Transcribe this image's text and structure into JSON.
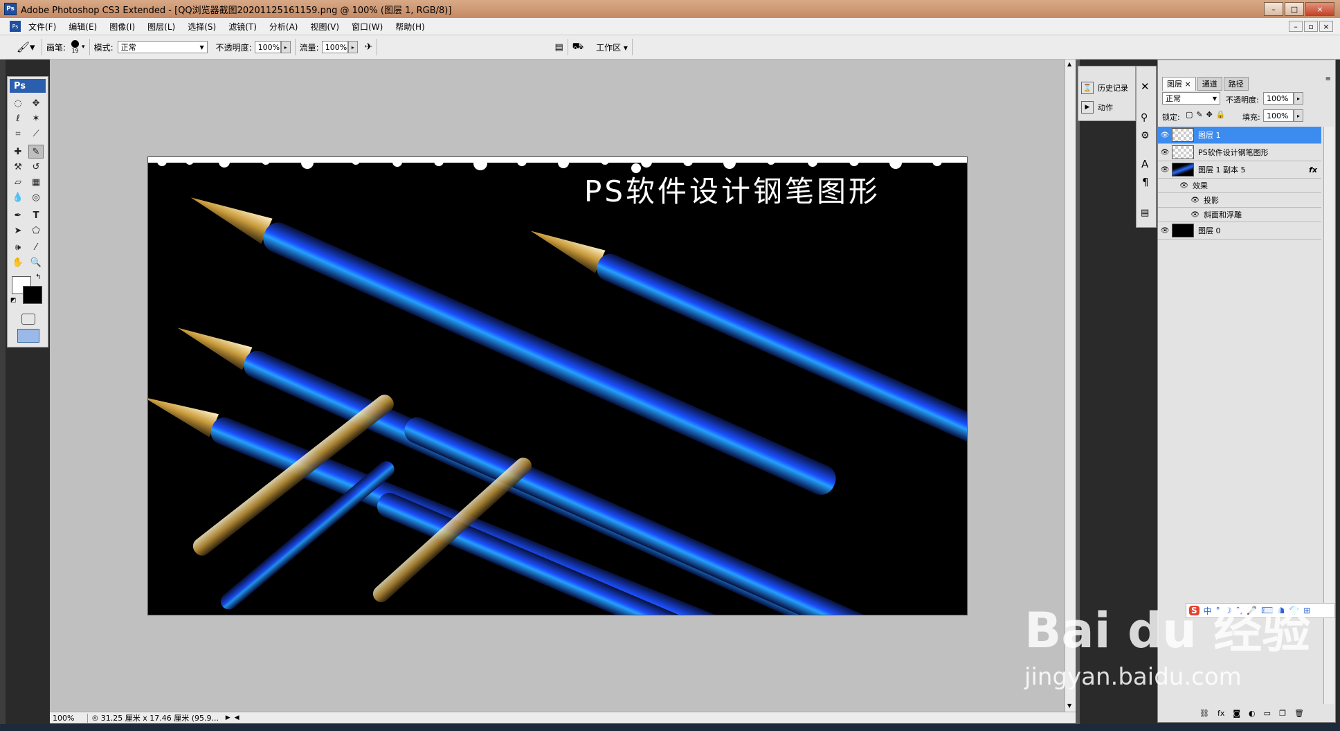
{
  "window": {
    "title": "Adobe Photoshop CS3 Extended - [QQ浏览器截图20201125161159.png @ 100% (图层 1, RGB/8)]",
    "app_icon": "Ps",
    "controls": [
      "–",
      "□",
      "×"
    ],
    "doc_controls": [
      "–",
      "▫",
      "×"
    ]
  },
  "menu": [
    "文件(F)",
    "编辑(E)",
    "图像(I)",
    "图层(L)",
    "选择(S)",
    "滤镜(T)",
    "分析(A)",
    "视图(V)",
    "窗口(W)",
    "帮助(H)"
  ],
  "options": {
    "brush_label": "画笔:",
    "brush_size": "19",
    "mode_label": "模式:",
    "mode_value": "正常",
    "opacity_label": "不透明度:",
    "opacity_value": "100%",
    "flow_label": "流量:",
    "flow_value": "100%",
    "workspace_label": "工作区 ▾"
  },
  "toolbox": {
    "logo": "Ps"
  },
  "canvas": {
    "text": "PS软件设计钢笔图形",
    "bg_color": "#000000",
    "accent_blue": "#1a5aff"
  },
  "status": {
    "zoom": "100%",
    "doc_info": "31.25 厘米 x 17.46 厘米 (95.9..."
  },
  "history_panel": {
    "items": [
      {
        "label": "历史记录",
        "icon": "history-icon"
      },
      {
        "label": "动作",
        "icon": "actions-icon"
      }
    ]
  },
  "layers_panel": {
    "tabs": [
      "图层",
      "通道",
      "路径"
    ],
    "blend_mode": "正常",
    "opacity_label": "不透明度:",
    "opacity_value": "100%",
    "lock_label": "锁定:",
    "fill_label": "填充:",
    "fill_value": "100%",
    "layers": [
      {
        "name": "图层 1",
        "selected": true,
        "thumb": "transparent"
      },
      {
        "name": "PS软件设计钢笔图形",
        "selected": false,
        "thumb": "transparent"
      },
      {
        "name": "图层 1 副本 5",
        "selected": false,
        "thumb": "image",
        "fx": "fx"
      },
      {
        "name": "效果",
        "sub": true,
        "level": 1
      },
      {
        "name": "投影",
        "sub": true,
        "level": 2
      },
      {
        "name": "斜面和浮雕",
        "sub": true,
        "level": 2
      },
      {
        "name": "图层 0",
        "selected": false,
        "thumb": "black"
      }
    ]
  },
  "ime_bar": {
    "items": [
      "S",
      "中",
      "°",
      "☽",
      "°,",
      "🎤",
      "⌨",
      "☗",
      "👕",
      "⊞"
    ]
  },
  "watermark": {
    "logo": "Bai du 经验",
    "url": "jingyan.baidu.com"
  }
}
